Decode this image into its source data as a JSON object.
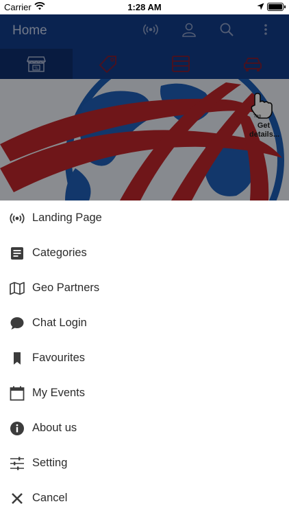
{
  "status_bar": {
    "carrier": "Carrier",
    "time": "1:28 AM"
  },
  "header": {
    "title": "Home"
  },
  "hero": {
    "tap_text": "Tap",
    "details_text": "Get details..."
  },
  "tabs": [
    {
      "icon": "store-icon",
      "active": true
    },
    {
      "icon": "tag-icon",
      "active": false
    },
    {
      "icon": "list-icon",
      "active": false
    },
    {
      "icon": "car-icon",
      "active": false
    }
  ],
  "colors": {
    "header": "#123d8b",
    "accent_red": "#c0262b",
    "menu_text": "#2b2b2b",
    "icon": "#3c3c3c"
  },
  "menu": {
    "items": [
      {
        "label": "Landing Page",
        "icon": "broadcast-icon"
      },
      {
        "label": "Categories",
        "icon": "document-icon"
      },
      {
        "label": "Geo Partners",
        "icon": "map-icon"
      },
      {
        "label": "Chat Login",
        "icon": "chat-icon"
      },
      {
        "label": "Favourites",
        "icon": "bookmark-icon"
      },
      {
        "label": "My Events",
        "icon": "calendar-icon"
      },
      {
        "label": "About us",
        "icon": "info-icon"
      },
      {
        "label": "Setting",
        "icon": "sliders-icon"
      },
      {
        "label": "Cancel",
        "icon": "close-icon"
      }
    ]
  }
}
